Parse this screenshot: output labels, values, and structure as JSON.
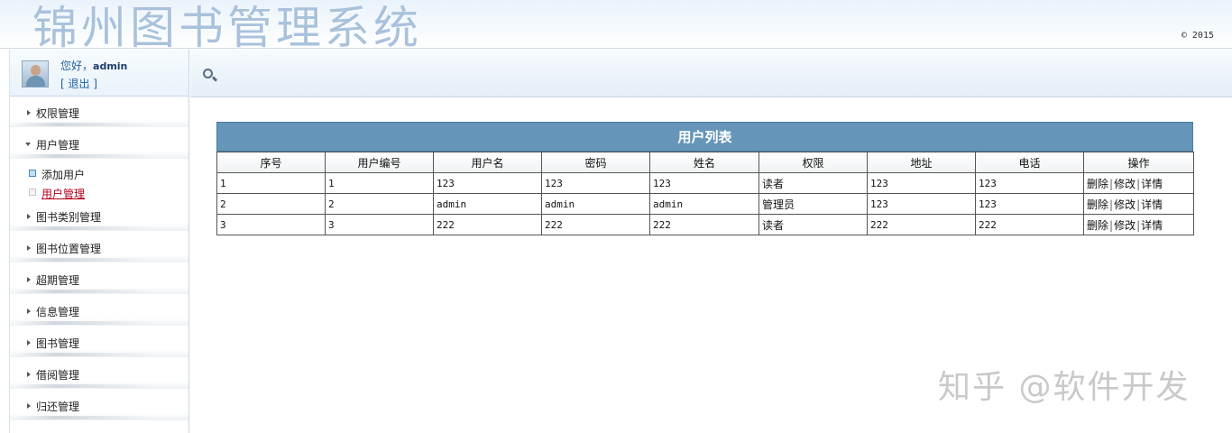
{
  "header": {
    "title": "锦州图书管理系统",
    "copyright": "© 2015"
  },
  "user": {
    "greeting": "您好，",
    "name": "admin",
    "logout": "[ 退出 ]"
  },
  "sidebar": {
    "items": [
      {
        "label": "权限管理",
        "expanded": false
      },
      {
        "label": "用户管理",
        "expanded": true
      },
      {
        "label": "图书类别管理",
        "expanded": false
      },
      {
        "label": "图书位置管理",
        "expanded": false
      },
      {
        "label": "超期管理",
        "expanded": false
      },
      {
        "label": "信息管理",
        "expanded": false
      },
      {
        "label": "图书管理",
        "expanded": false
      },
      {
        "label": "借阅管理",
        "expanded": false
      },
      {
        "label": "归还管理",
        "expanded": false
      }
    ],
    "submenu": [
      {
        "label": "添加用户",
        "active": false
      },
      {
        "label": "用户管理",
        "active": true
      }
    ]
  },
  "table": {
    "caption": "用户列表",
    "columns": [
      "序号",
      "用户编号",
      "用户名",
      "密码",
      "姓名",
      "权限",
      "地址",
      "电话",
      "操作"
    ],
    "rows": [
      [
        "1",
        "1",
        "123",
        "123",
        "123",
        "读者",
        "123",
        "123"
      ],
      [
        "2",
        "2",
        "admin",
        "admin",
        "admin",
        "管理员",
        "123",
        "123"
      ],
      [
        "3",
        "3",
        "222",
        "222",
        "222",
        "读者",
        "222",
        "222"
      ]
    ],
    "actions": {
      "delete": "删除",
      "edit": "修改",
      "detail": "详情",
      "separator": "|"
    }
  },
  "watermark": "知乎 @软件开发",
  "colors": {
    "caption_bg": "#6596b9",
    "active_link": "#b3001b",
    "title": "#a9c2dc"
  }
}
